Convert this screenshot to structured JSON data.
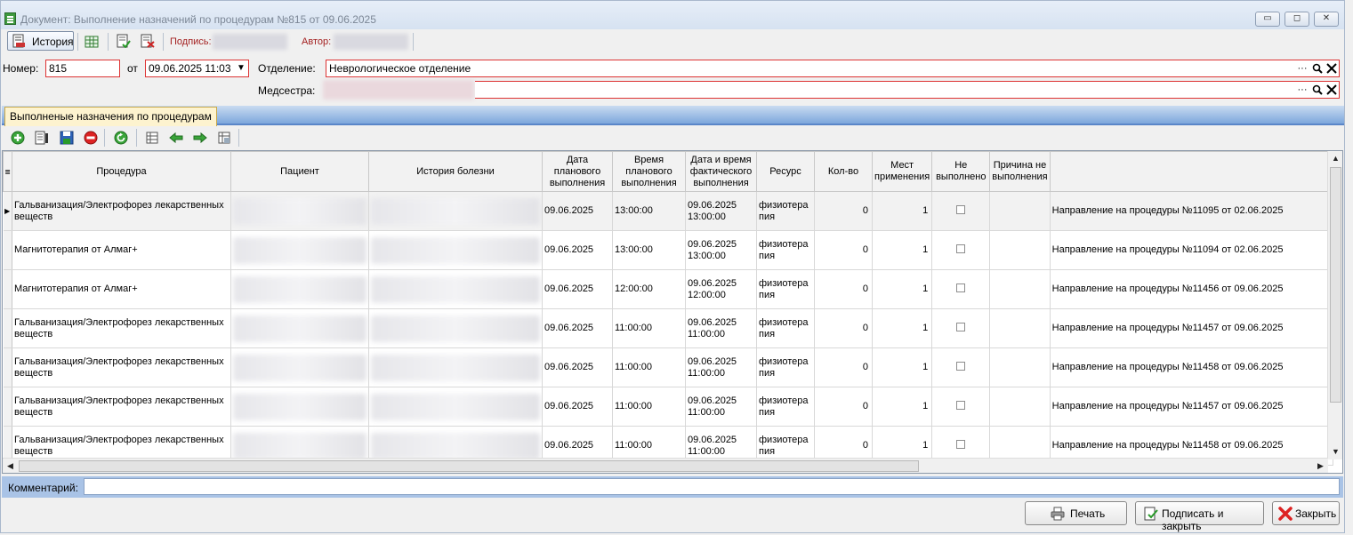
{
  "window": {
    "title": "Документ: Выполнение назначений по процедурам №815 от 09.06.2025",
    "min_glyph": "▭",
    "max_glyph": "◻",
    "close_glyph": "✕"
  },
  "toolbar": {
    "history_label": "История",
    "sign_label": "Подпись:",
    "author_label": "Автор:"
  },
  "form": {
    "number_label": "Номер:",
    "number_value": "815",
    "from_label": "от",
    "date_value": "09.06.2025 11:03",
    "department_label": "Отделение:",
    "department_value": "Неврологическое отделение",
    "nurse_label": "Медсестра:",
    "nurse_value": ""
  },
  "tabs": [
    "Выполненые назначения по процедурам"
  ],
  "grid": {
    "columns": [
      "Процедура",
      "Пациент",
      "История болезни",
      "Дата планового выполнения",
      "Время планового выполнения",
      "Дата и время фактического выполнения",
      "Ресурс",
      "Кол-во",
      "Мест применения",
      "Не выполнено",
      "Причина не выполнения",
      ""
    ],
    "rows": [
      {
        "procedure": "Гальванизация/Электрофорез лекарственных веществ",
        "plan_date": "09.06.2025",
        "plan_time": "13:00:00",
        "fact_date": "09.06.2025",
        "fact_time": "13:00:00",
        "resource": "физиотерапия",
        "qty": "0",
        "places": "1",
        "referral": "Направление на процедуры №11095 от 02.06.2025"
      },
      {
        "procedure": "Магнитотерапия от Алмаг+",
        "plan_date": "09.06.2025",
        "plan_time": "13:00:00",
        "fact_date": "09.06.2025",
        "fact_time": "13:00:00",
        "resource": "физиотерапия",
        "qty": "0",
        "places": "1",
        "referral": "Направление на процедуры №11094 от 02.06.2025"
      },
      {
        "procedure": "Магнитотерапия от Алмаг+",
        "plan_date": "09.06.2025",
        "plan_time": "12:00:00",
        "fact_date": "09.06.2025",
        "fact_time": "12:00:00",
        "resource": "физиотерапия",
        "qty": "0",
        "places": "1",
        "referral": "Направление на процедуры №11456 от 09.06.2025"
      },
      {
        "procedure": "Гальванизация/Электрофорез лекарственных веществ",
        "plan_date": "09.06.2025",
        "plan_time": "11:00:00",
        "fact_date": "09.06.2025",
        "fact_time": "11:00:00",
        "resource": "физиотерапия",
        "qty": "0",
        "places": "1",
        "referral": "Направление на процедуры №11457 от 09.06.2025"
      },
      {
        "procedure": "Гальванизация/Электрофорез лекарственных веществ",
        "plan_date": "09.06.2025",
        "plan_time": "11:00:00",
        "fact_date": "09.06.2025",
        "fact_time": "11:00:00",
        "resource": "физиотерапия",
        "qty": "0",
        "places": "1",
        "referral": "Направление на процедуры №11458 от 09.06.2025"
      },
      {
        "procedure": "Гальванизация/Электрофорез лекарственных веществ",
        "plan_date": "09.06.2025",
        "plan_time": "11:00:00",
        "fact_date": "09.06.2025",
        "fact_time": "11:00:00",
        "resource": "физиотерапия",
        "qty": "0",
        "places": "1",
        "referral": "Направление на процедуры №11457 от 09.06.2025"
      },
      {
        "procedure": "Гальванизация/Электрофорез лекарственных веществ",
        "plan_date": "09.06.2025",
        "plan_time": "11:00:00",
        "fact_date": "09.06.2025",
        "fact_time": "11:00:00",
        "resource": "физиотерапия",
        "qty": "0",
        "places": "1",
        "referral": "Направление на процедуры №11458 от 09.06.2025"
      }
    ]
  },
  "comment": {
    "label": "Комментарий:",
    "value": ""
  },
  "buttons": {
    "print": "Печать",
    "sign_close": "Подписать и закрыть",
    "close": "Закрыть"
  },
  "colors": {
    "accent": "#5a86c8",
    "required_border": "#dd3333",
    "tab_bg": "#fdf3cf"
  }
}
